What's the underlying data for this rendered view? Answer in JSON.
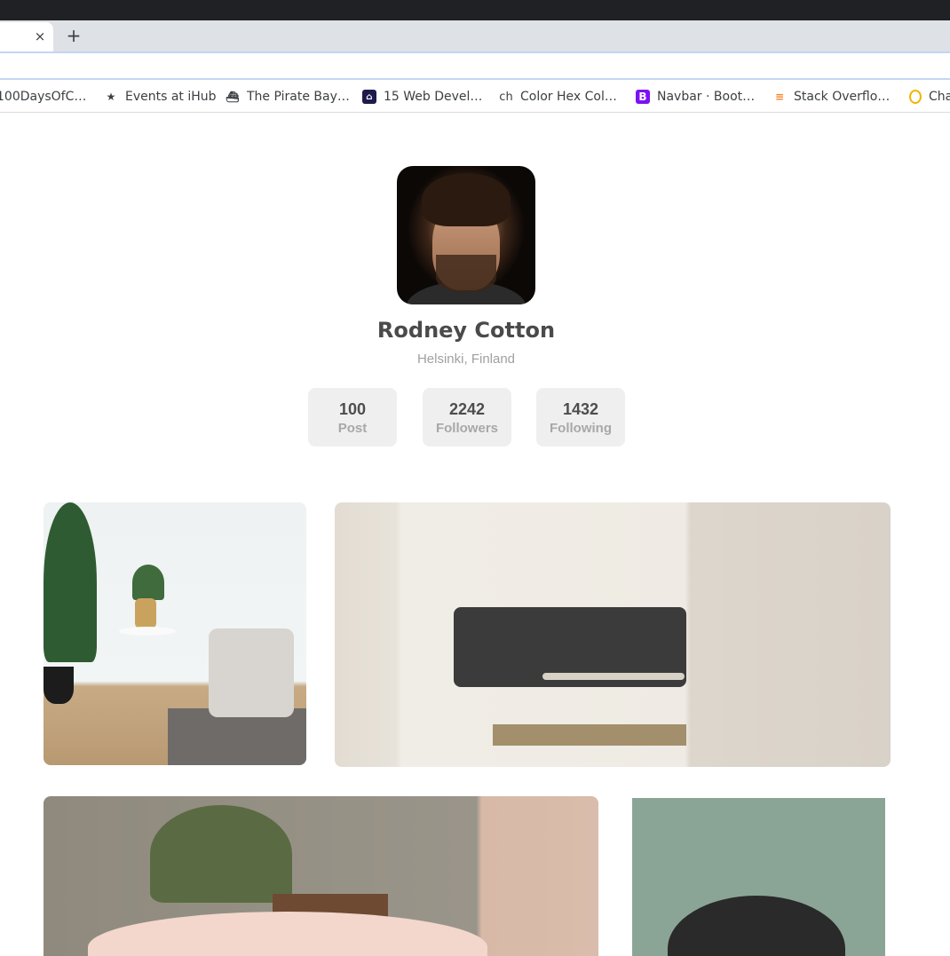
{
  "browser": {
    "tab_close": "×",
    "new_tab": "+",
    "bookmarks": [
      {
        "label": "100DaysOfC…",
        "icon": "none"
      },
      {
        "label": "Events at iHub",
        "icon": "star-icon"
      },
      {
        "label": "The Pirate Bay…",
        "icon": "ship-icon"
      },
      {
        "label": "15 Web Devel…",
        "icon": "code-icon"
      },
      {
        "label": "Color Hex Col…",
        "icon": "ch-icon"
      },
      {
        "label": "Navbar · Boot…",
        "icon": "bootstrap-icon"
      },
      {
        "label": "Stack Overflo…",
        "icon": "stackoverflow-icon"
      },
      {
        "label": "Cha",
        "icon": "circle-icon"
      }
    ]
  },
  "profile": {
    "name": "Rodney Cotton",
    "location": "Helsinki, Finland",
    "stats": [
      {
        "value": "100",
        "label": "Post"
      },
      {
        "value": "2242",
        "label": "Followers"
      },
      {
        "value": "1432",
        "label": "Following"
      }
    ]
  },
  "colors": {
    "name_text": "#4a4a4a",
    "muted_text": "#a0a0a0",
    "stat_bg": "#efefef"
  }
}
